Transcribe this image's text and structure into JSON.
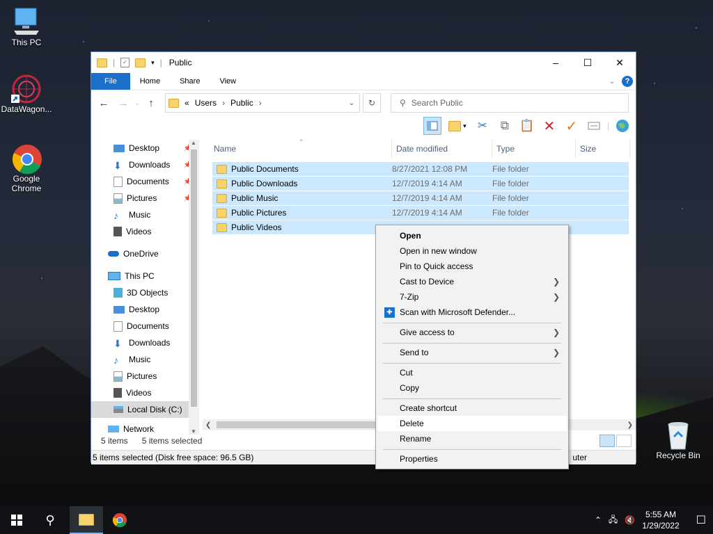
{
  "desktop": {
    "icons": [
      {
        "label": "This PC"
      },
      {
        "label": "DataWagon..."
      },
      {
        "label": "Google Chrome"
      },
      {
        "label": "Recycle Bin"
      }
    ]
  },
  "window": {
    "title": "Public",
    "tabs": [
      "File",
      "Home",
      "Share",
      "View"
    ],
    "help": "?",
    "address": {
      "prefix": "«",
      "segments": [
        "Users",
        "Public"
      ]
    },
    "search_placeholder": "Search Public",
    "sidebar": [
      {
        "label": "Desktop",
        "pinned": true
      },
      {
        "label": "Downloads",
        "pinned": true
      },
      {
        "label": "Documents",
        "pinned": true
      },
      {
        "label": "Pictures",
        "pinned": true
      },
      {
        "label": "Music"
      },
      {
        "label": "Videos"
      },
      {
        "label": "OneDrive"
      },
      {
        "label": "This PC"
      },
      {
        "label": "3D Objects"
      },
      {
        "label": "Desktop"
      },
      {
        "label": "Documents"
      },
      {
        "label": "Downloads"
      },
      {
        "label": "Music"
      },
      {
        "label": "Pictures"
      },
      {
        "label": "Videos"
      },
      {
        "label": "Local Disk (C:)"
      },
      {
        "label": "Network"
      }
    ],
    "columns": [
      "Name",
      "Date modified",
      "Type",
      "Size"
    ],
    "files": [
      {
        "name": "Public Documents",
        "date": "8/27/2021 12:08 PM",
        "type": "File folder"
      },
      {
        "name": "Public Downloads",
        "date": "12/7/2019 4:14 AM",
        "type": "File folder"
      },
      {
        "name": "Public Music",
        "date": "12/7/2019 4:14 AM",
        "type": "File folder"
      },
      {
        "name": "Public Pictures",
        "date": "12/7/2019 4:14 AM",
        "type": "File folder"
      },
      {
        "name": "Public Videos",
        "date": "",
        "type": ""
      }
    ],
    "status": {
      "count": "5 items",
      "selected": "5 items selected"
    },
    "status_bar": {
      "text": "5 items selected (Disk free space: 96.5 GB)",
      "right": "uter"
    }
  },
  "context_menu": {
    "items": [
      {
        "label": "Open"
      },
      {
        "label": "Open in new window"
      },
      {
        "label": "Pin to Quick access"
      },
      {
        "label": "Cast to Device"
      },
      {
        "label": "7-Zip"
      },
      {
        "label": "Scan with Microsoft Defender..."
      },
      {
        "label": "Give access to"
      },
      {
        "label": "Send to"
      },
      {
        "label": "Cut"
      },
      {
        "label": "Copy"
      },
      {
        "label": "Create shortcut"
      },
      {
        "label": "Delete"
      },
      {
        "label": "Rename"
      },
      {
        "label": "Properties"
      }
    ]
  },
  "taskbar": {
    "time": "5:55 AM",
    "date": "1/29/2022"
  },
  "colors": {
    "accent": "#1a6fc8",
    "selection": "#cce8ff",
    "folder": "#f7d36b"
  }
}
